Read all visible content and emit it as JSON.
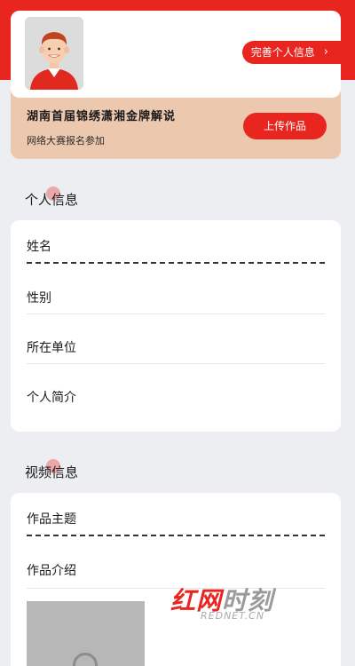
{
  "profile": {
    "complete_label": "完善个人信息",
    "complete_icon": "chevron-right-icon",
    "avatar_icon": "user-avatar-icon"
  },
  "contest": {
    "title": "湖南首届锦绣潇湘金牌解说",
    "subtitle": "网络大赛报名参加",
    "upload_label": "上传作品"
  },
  "personal_section": {
    "title": "个人信息",
    "fields": [
      "姓名",
      "性别",
      "所在单位",
      "个人简介"
    ]
  },
  "video_section": {
    "title": "视频信息",
    "fields": [
      "作品主题",
      "作品介绍"
    ]
  },
  "watermark": {
    "brand_red": "红网",
    "brand_grey": "时刻",
    "domain": "REDNET.CN"
  },
  "colors": {
    "accent": "#e8261f",
    "contest_bg": "#ecc8ae",
    "page_bg": "#eceef2"
  }
}
